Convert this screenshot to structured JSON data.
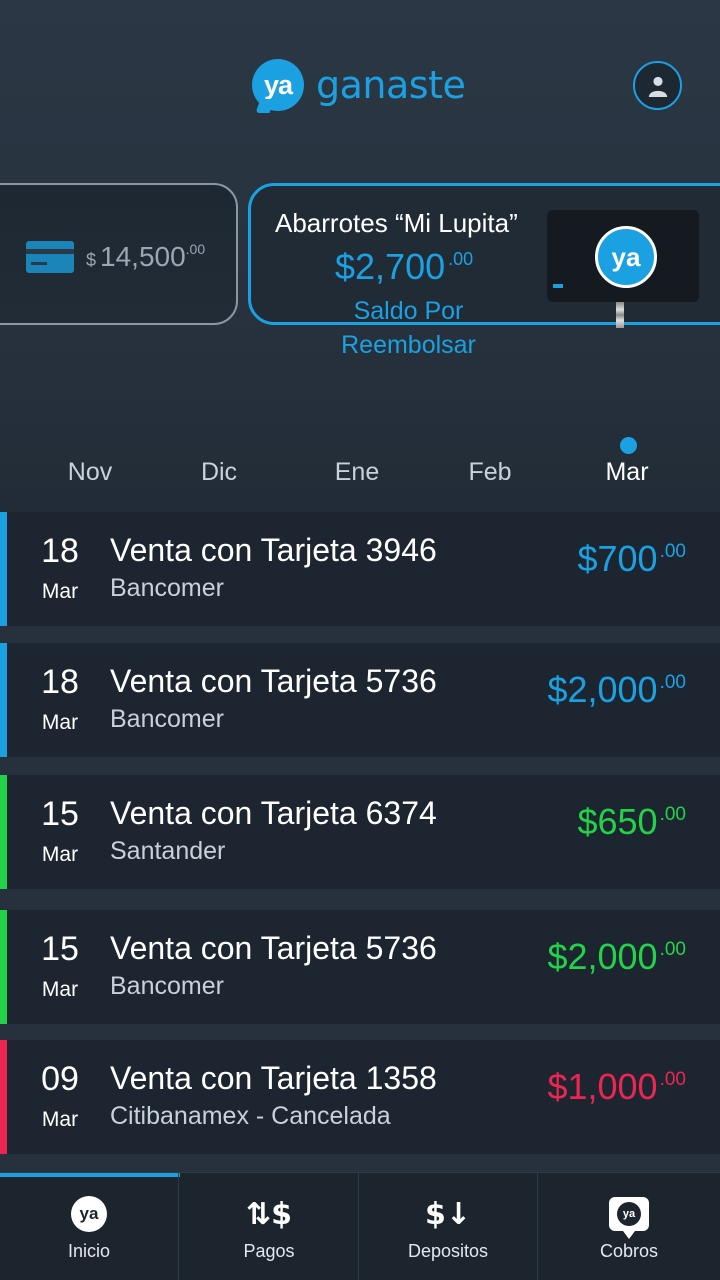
{
  "header": {
    "logo_mark": "ya",
    "logo_text": "ganaste",
    "profile_icon": "user-icon"
  },
  "cards": {
    "left": {
      "currency": "$",
      "amount": "14,500",
      "cents": ".00",
      "icon": "credit-card-icon"
    },
    "main": {
      "store_name": "Abarrotes “Mi Lupita”",
      "amount": "$2,700",
      "cents": ".00",
      "label_line1": "Saldo Por",
      "label_line2": "Reembolsar",
      "reader_badge": "ya"
    }
  },
  "months": {
    "items": [
      "Nov",
      "Dic",
      "Ene",
      "Feb",
      "Mar"
    ],
    "selected": "Mar"
  },
  "transactions": [
    {
      "day": "18",
      "month": "Mar",
      "title": "Venta con Tarjeta 3946",
      "bank": "Bancomer",
      "amount": "$700",
      "cents": ".00",
      "color": "#1ba1e2"
    },
    {
      "day": "18",
      "month": "Mar",
      "title": "Venta con Tarjeta 5736",
      "bank": "Bancomer",
      "amount": "$2,000",
      "cents": ".00",
      "color": "#1ba1e2"
    },
    {
      "day": "15",
      "month": "Mar",
      "title": "Venta con Tarjeta 6374",
      "bank": "Santander",
      "amount": "$650",
      "cents": ".00",
      "color": "#22d34a"
    },
    {
      "day": "15",
      "month": "Mar",
      "title": "Venta con Tarjeta 5736",
      "bank": "Bancomer",
      "amount": "$2,000",
      "cents": ".00",
      "color": "#22d34a"
    },
    {
      "day": "09",
      "month": "Mar",
      "title": "Venta con Tarjeta 1358",
      "bank": "Citibanamex - Cancelada",
      "amount": "$1,000",
      "cents": ".00",
      "color": "#ec2553"
    }
  ],
  "nav": {
    "items": [
      {
        "label": "Inicio",
        "icon": "ya-home-icon",
        "glyph": "ya"
      },
      {
        "label": "Pagos",
        "icon": "payments-icon",
        "glyph": "⇅$"
      },
      {
        "label": "Depositos",
        "icon": "deposits-icon",
        "glyph": "$↓"
      },
      {
        "label": "Cobros",
        "icon": "collections-chat-icon",
        "glyph": "ya"
      }
    ],
    "active": "Inicio"
  }
}
